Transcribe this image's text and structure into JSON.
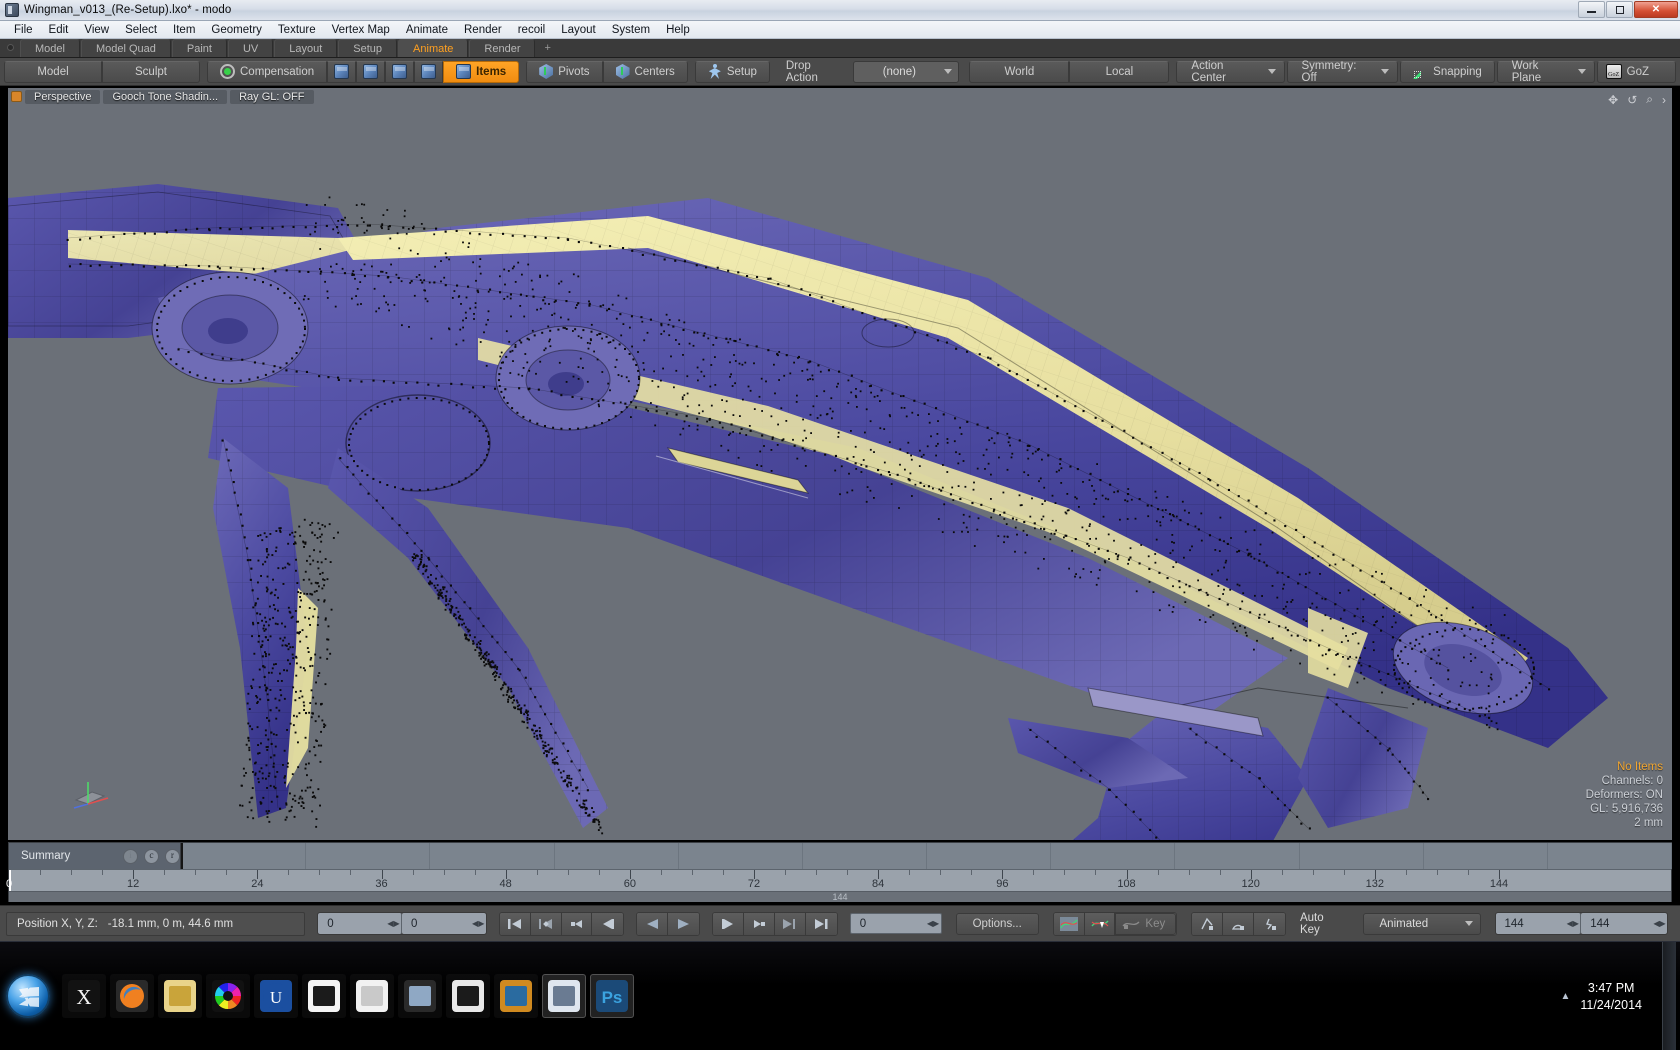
{
  "window": {
    "title": "Wingman_v013_(Re-Setup).lxo* - modo",
    "icon": "modo-app-icon",
    "controls": {
      "minimize": "minimize-button",
      "maximize": "maximize-button",
      "close": "close-button"
    }
  },
  "menubar": {
    "items": [
      "File",
      "Edit",
      "View",
      "Select",
      "Item",
      "Geometry",
      "Texture",
      "Vertex Map",
      "Animate",
      "Render",
      "recoil",
      "Layout",
      "System",
      "Help"
    ]
  },
  "layout_tabs": {
    "items": [
      "Model",
      "Model Quad",
      "Paint",
      "UV",
      "Layout",
      "Setup",
      "Animate",
      "Render"
    ],
    "active": "Animate",
    "add_label": "+"
  },
  "toolbar": {
    "mode_group": [
      "Model",
      "Sculpt"
    ],
    "compensation_label": "Compensation",
    "compensation_icon": "green-dot-icon",
    "selection_modes": [
      {
        "name": "vertices-mode-icon",
        "label": ""
      },
      {
        "name": "edges-mode-icon",
        "label": ""
      },
      {
        "name": "polygons-mode-icon",
        "label": ""
      },
      {
        "name": "materials-mode-icon",
        "label": ""
      },
      {
        "name": "items-mode",
        "label": "Items",
        "active": true
      }
    ],
    "pivots_label": "Pivots",
    "centers_label": "Centers",
    "setup_label": "Setup",
    "drop_action_label": "Drop Action",
    "drop_action_value": "(none)",
    "world_label": "World",
    "local_label": "Local",
    "action_center_label": "Action Center",
    "symmetry_label": "Symmetry: Off",
    "snapping_label": "Snapping",
    "work_plane_label": "Work Plane",
    "goz_label": "GoZ"
  },
  "viewport": {
    "view_label": "Perspective",
    "shading_label": "Gooch Tone Shadin...",
    "raygl_label": "Ray GL: OFF",
    "tools": [
      "move-view-icon",
      "rotate-view-icon",
      "zoom-view-icon",
      "expand-view-icon"
    ],
    "stats": {
      "items": "No Items",
      "channels": "Channels: 0",
      "deformers": "Deformers: ON",
      "gl": "GL: 5,916,736",
      "scale": "2 mm"
    },
    "accent_color": "#f0a530",
    "background_color": "#6b7078",
    "model_color": "#4b49a0",
    "highlight_color": "#ede6a0"
  },
  "timeline": {
    "summary_label": "Summary",
    "channel_buttons": [
      "i",
      "c",
      "r"
    ],
    "ticks": [
      0,
      12,
      24,
      36,
      48,
      60,
      72,
      84,
      96,
      108,
      120,
      132,
      144
    ],
    "range_start": 0,
    "range_end": 144,
    "current_frame": 0,
    "footer_label": "144"
  },
  "statusbar": {
    "position_label": "Position X, Y, Z:",
    "position_value": "-18.1 mm, 0 m, 44.6 mm",
    "frame_field_a": "0",
    "frame_field_b": "0",
    "transport": [
      "go-to-start-icon",
      "previous-key-icon",
      "step-back-key-icon",
      "step-back-frame-icon",
      "play-reverse-icon",
      "play-forward-icon",
      "step-forward-frame-icon",
      "step-forward-key-icon",
      "next-key-icon",
      "go-to-end-icon"
    ],
    "frame_field_c": "0",
    "options_label": "Options...",
    "curve_icons": [
      "graph-editor-icon",
      "set-key-icon"
    ],
    "key_label": "Key",
    "transform_icons": [
      "key-channels-icon",
      "key-envelope-icon",
      "key-item-icon"
    ],
    "auto_key_label": "Auto Key",
    "animated_label": "Animated",
    "range_field_a": "144",
    "range_field_b": "144"
  },
  "taskbar": {
    "start_label": "start-orb",
    "icons": [
      "xnormal-icon",
      "firefox-icon",
      "windows-explorer-icon",
      "color-wheel-icon",
      "unreal-engine-icon",
      "mixamo-fuse-icon",
      "document-icon",
      "camera-raw-icon",
      "quixel-icon",
      "image-viewer-icon",
      "modo-icon",
      "photoshop-icon"
    ],
    "tray_arrow": "show-hidden-icons-arrow",
    "time": "3:47 PM",
    "date": "11/24/2014"
  }
}
